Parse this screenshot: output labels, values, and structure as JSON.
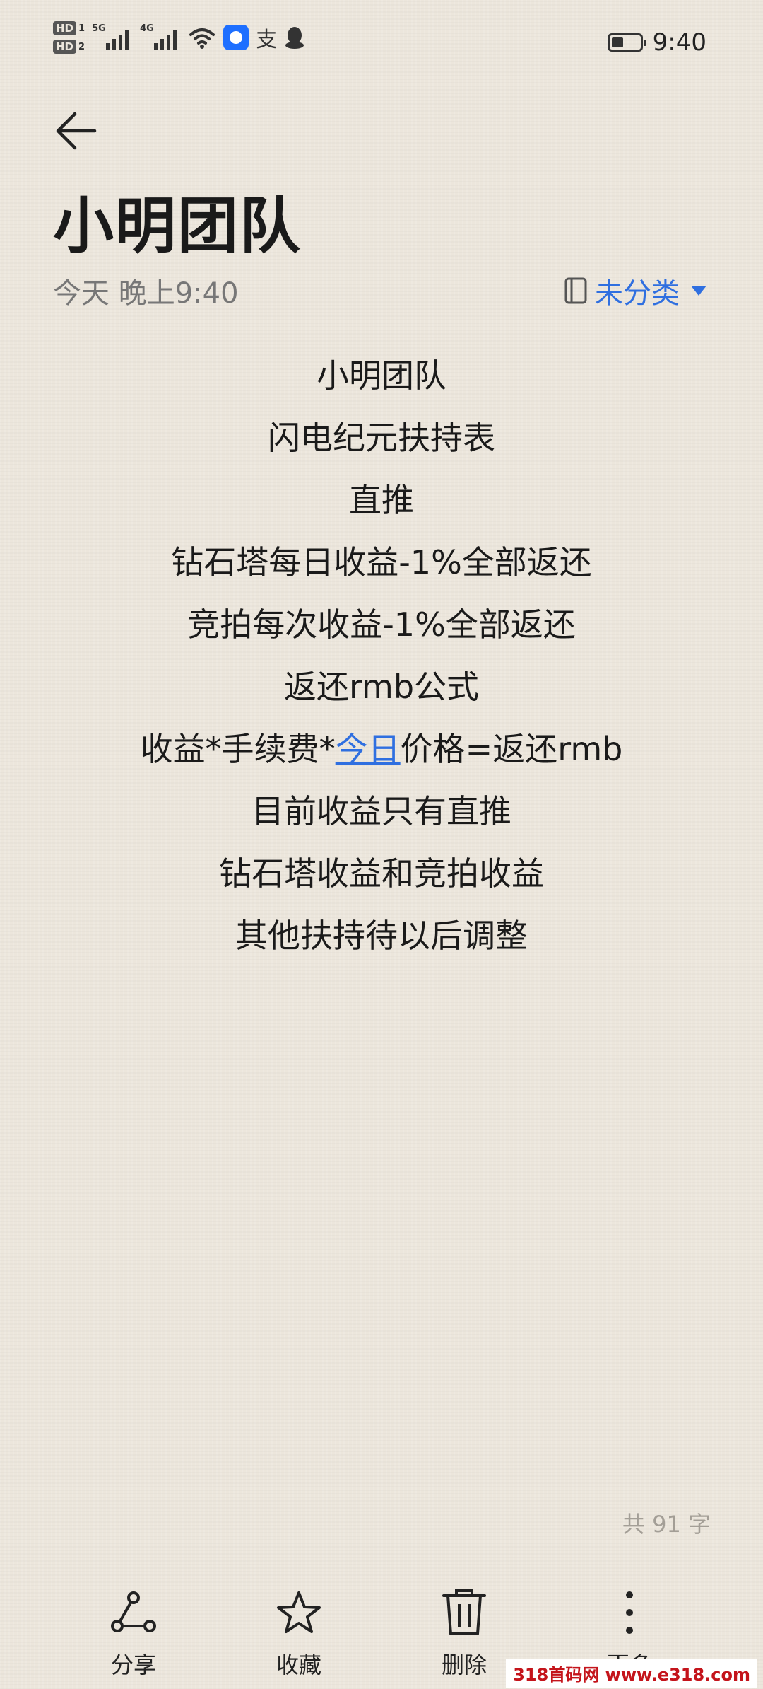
{
  "status_bar": {
    "hd1": "HD",
    "hd1_sim": "1",
    "hd2": "HD",
    "hd2_sim": "2",
    "signal1": "5G",
    "signal2": "4G",
    "alipay_glyph": "支",
    "time": "9:40"
  },
  "note": {
    "title": "小明团队",
    "date": "今天 晚上9:40",
    "category": "未分类",
    "lines": [
      "小明团队",
      "闪电纪元扶持表",
      "直推",
      "钻石塔每日收益-1%全部返还",
      "竞拍每次收益-1%全部返还",
      "返还rmb公式",
      {
        "before": "收益*手续费*",
        "link": "今日",
        "after": "价格=返还rmb"
      },
      "目前收益只有直推",
      "钻石塔收益和竞拍收益",
      "其他扶持待以后调整"
    ],
    "word_count": "共 91 字"
  },
  "toolbar": {
    "share": "分享",
    "favorite": "收藏",
    "delete": "删除",
    "more": "更多"
  },
  "watermark": {
    "text": "318首码网 www.e318.com"
  },
  "colors": {
    "background": "#ece6dc",
    "accent": "#2f6fe0",
    "text": "#1a1a1a",
    "meta": "#777777",
    "watermark": "#c4141b"
  },
  "icons": [
    "back-arrow-icon",
    "notebook-icon",
    "share-icon",
    "star-icon",
    "trash-icon",
    "more-vertical-icon"
  ]
}
